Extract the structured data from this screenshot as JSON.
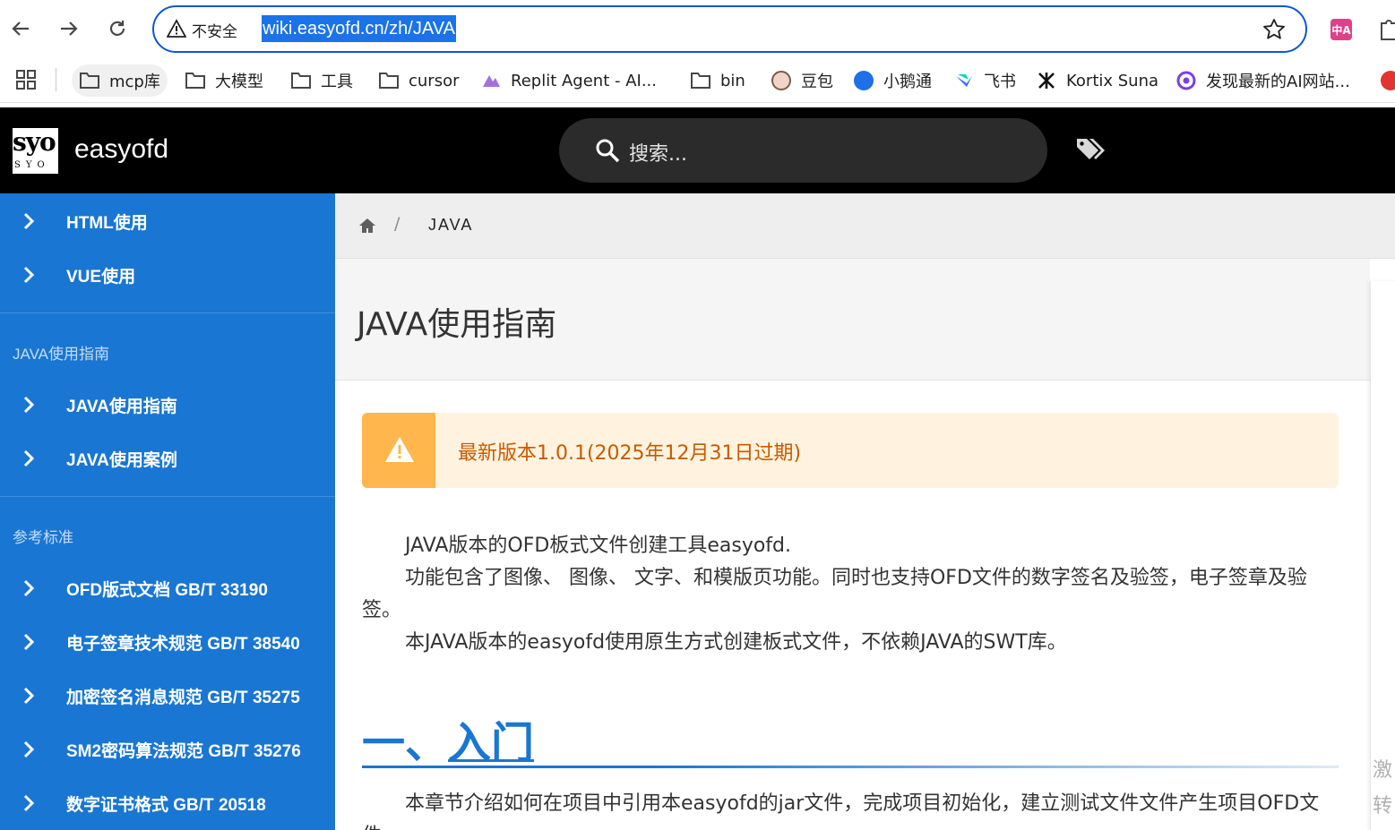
{
  "browser": {
    "insecure_label": "不安全",
    "url": "wiki.easyofd.cn/zh/JAVA",
    "extension_label": "中A",
    "bookmarks": [
      {
        "label": "mcp库",
        "icon": "folder-icon"
      },
      {
        "label": "大模型",
        "icon": "folder-icon"
      },
      {
        "label": "工具",
        "icon": "folder-icon"
      },
      {
        "label": "cursor",
        "icon": "folder-icon"
      },
      {
        "label": "Replit Agent - AI...",
        "icon": "replit-icon"
      },
      {
        "label": "bin",
        "icon": "folder-icon"
      },
      {
        "label": "豆包",
        "icon": "doubao-icon"
      },
      {
        "label": "小鹅通",
        "icon": "xiaoetong-icon"
      },
      {
        "label": "飞书",
        "icon": "feishu-icon"
      },
      {
        "label": "Kortix Suna",
        "icon": "kortix-icon"
      },
      {
        "label": "发现最新的AI网站...",
        "icon": "ai-site-icon"
      }
    ]
  },
  "header": {
    "logo_text": "syo",
    "logo_small": "SYO",
    "site_name": "easyofd",
    "search_placeholder": "搜索..."
  },
  "sidebar": {
    "group1": [
      {
        "label": "HTML使用"
      },
      {
        "label": "VUE使用"
      }
    ],
    "section2_title": "JAVA使用指南",
    "group2": [
      {
        "label": "JAVA使用指南"
      },
      {
        "label": "JAVA使用案例"
      }
    ],
    "section3_title": "参考标准",
    "group3": [
      {
        "label": "OFD版式文档 GB/T 33190"
      },
      {
        "label": "电子签章技术规范 GB/T 38540"
      },
      {
        "label": "加密签名消息规范 GB/T 35275"
      },
      {
        "label": "SM2密码算法规范 GB/T 35276"
      },
      {
        "label": "数字证书格式 GB/T 20518"
      }
    ]
  },
  "breadcrumb": {
    "separator": "/",
    "current": "JAVA"
  },
  "main": {
    "title": "JAVA使用指南",
    "alert": "最新版本1.0.1(2025年12月31日过期)",
    "paragraphs": [
      "JAVA版本的OFD板式文件创建工具easyofd.",
      "功能包含了图像、 图像、 文字、和模版页功能。同时也支持OFD文件的数字签名及验签，电子签章及验签。",
      "本JAVA版本的easyofd使用原生方式创建板式文件，不依赖JAVA的SWT库。"
    ],
    "h2_prefix": "一、",
    "h2_link": "入门",
    "intro": "本章节介绍如何在项目中引用本easyofd的jar文件，完成项目初始化，建立测试文件文件产生项目OFD文件"
  },
  "right_panel": {
    "line1": "激",
    "line2": "转"
  },
  "colors": {
    "sidebar": "#1976d2",
    "header": "#000000",
    "alert_bg": "#fff3e0",
    "alert_accent": "#ffb74d",
    "alert_text": "#c85a00"
  }
}
